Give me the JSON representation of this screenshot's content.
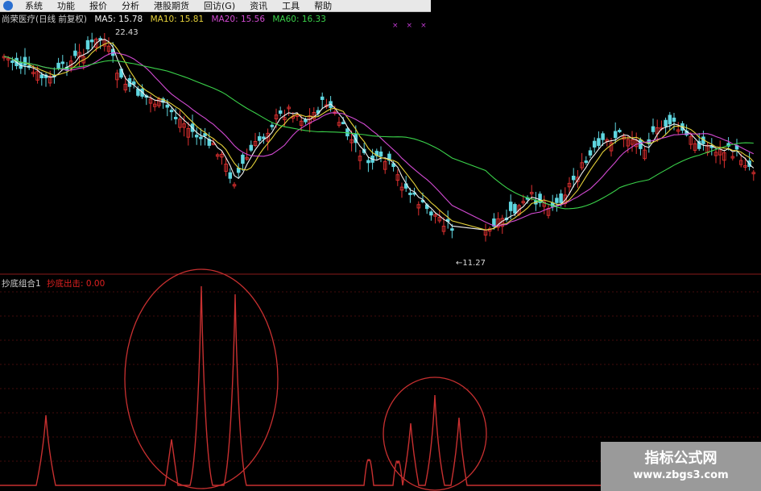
{
  "menu": {
    "items": [
      "系统",
      "功能",
      "报价",
      "分析",
      "港股期货",
      "回访(G)",
      "资讯",
      "工具",
      "帮助"
    ]
  },
  "info_bar": {
    "title": "尚荣医疗(日线 前复权)",
    "ma5": "MA5: 15.78",
    "ma10": "MA10: 15.81",
    "ma20": "MA20: 15.56",
    "ma60": "MA60: 16.33"
  },
  "price_high_label": "22.43",
  "price_low_label": "←11.27",
  "indicator": {
    "name": "抄底组合1",
    "value": "抄底出击: 0.00"
  },
  "watermark": {
    "line1": "指标公式网",
    "line2": "www.zbgs3.com"
  },
  "colors": {
    "up": "#e03030",
    "down": "#5fd6e0",
    "ma5": "#f2f2f2",
    "ma10": "#e6d23a",
    "ma20": "#d24ad2",
    "ma60": "#3ad24a",
    "indicator": "#c83030"
  }
}
